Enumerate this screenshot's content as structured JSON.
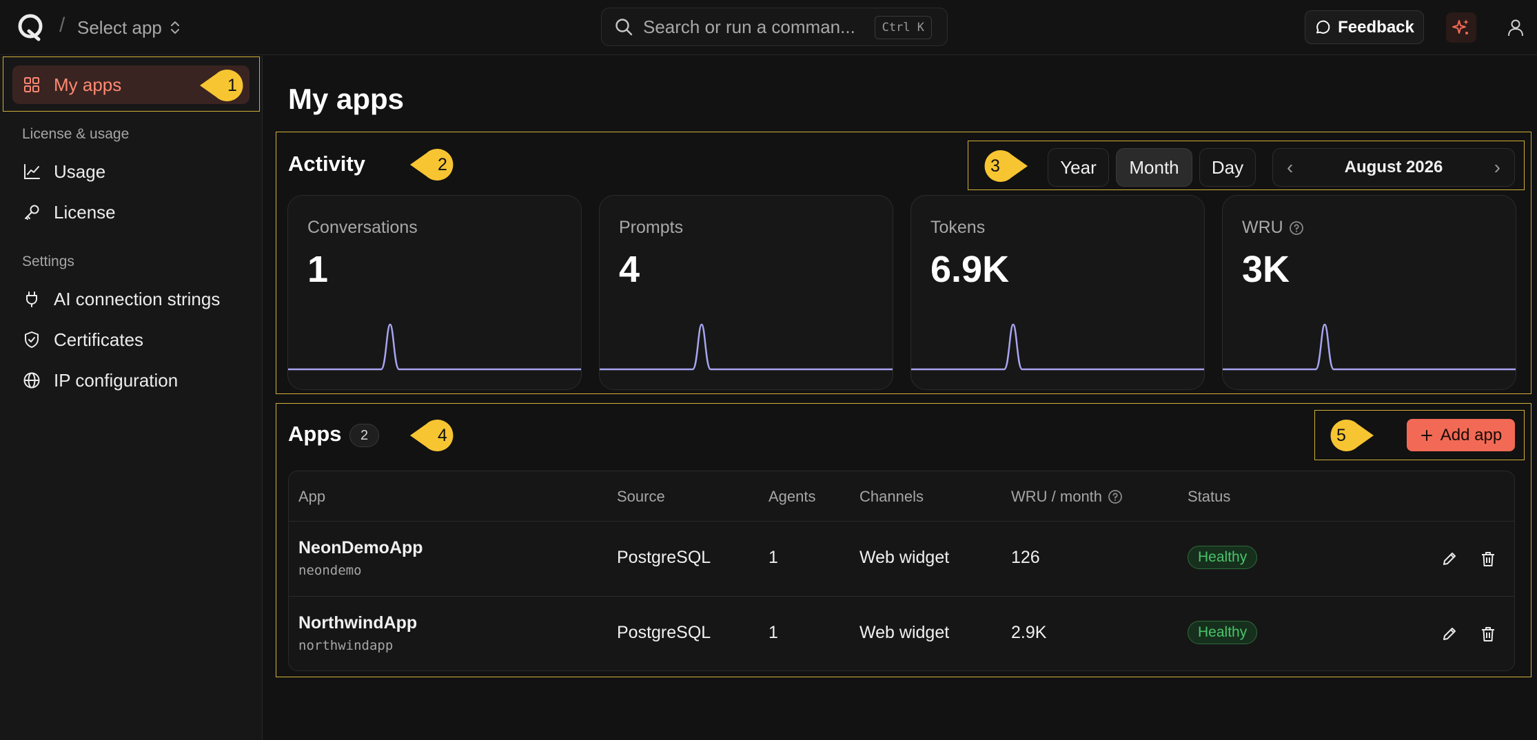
{
  "header": {
    "app_selector_label": "Select app",
    "breadcrumb_separator": "/",
    "search_placeholder": "Search or run a comman...",
    "search_shortcut": "Ctrl K",
    "feedback_label": "Feedback"
  },
  "sidebar": {
    "my_apps": "My apps",
    "license_heading": "License & usage",
    "usage": "Usage",
    "license": "License",
    "settings_heading": "Settings",
    "ai_connection_strings": "AI connection strings",
    "certificates": "Certificates",
    "ip_configuration": "IP configuration"
  },
  "main": {
    "title": "My apps",
    "activity_title": "Activity",
    "range_options": [
      "Year",
      "Month",
      "Day"
    ],
    "range_selected": "Month",
    "period": "August 2026",
    "metrics": [
      {
        "label": "Conversations",
        "value": "1",
        "help": false
      },
      {
        "label": "Prompts",
        "value": "4",
        "help": false
      },
      {
        "label": "Tokens",
        "value": "6.9K",
        "help": false
      },
      {
        "label": "WRU",
        "value": "3K",
        "help": true
      }
    ],
    "apps_title": "Apps",
    "apps_count": "2",
    "add_app_label": "Add app",
    "table": {
      "columns": [
        "App",
        "Source",
        "Agents",
        "Channels",
        "WRU / month",
        "Status"
      ],
      "rows": [
        {
          "name": "NeonDemoApp",
          "slug": "neondemo",
          "source": "PostgreSQL",
          "agents": "1",
          "channels": "Web widget",
          "wru": "126",
          "status": "Healthy"
        },
        {
          "name": "NorthwindApp",
          "slug": "northwindapp",
          "source": "PostgreSQL",
          "agents": "1",
          "channels": "Web widget",
          "wru": "2.9K",
          "status": "Healthy"
        }
      ]
    }
  },
  "annotations": [
    "1",
    "2",
    "3",
    "4",
    "5"
  ],
  "colors": {
    "accent": "#f26a55",
    "active_text": "#ff8a73",
    "sparkline": "#a8a4f0",
    "healthy": "#4bc46a",
    "annotation": "#f7c531"
  },
  "icons": {
    "logo": "app-logo",
    "selector": "chevron-up-down-icon",
    "search": "search-icon",
    "feedback": "message-circle-icon",
    "ai": "sparkles-icon",
    "user": "user-icon",
    "my_apps": "grid-icon",
    "usage": "chart-line-icon",
    "license": "key-icon",
    "ai_connection_strings": "plug-icon",
    "certificates": "shield-check-icon",
    "ip_configuration": "globe-icon",
    "help": "help-circle-icon",
    "prev": "chevron-left-icon",
    "next": "chevron-right-icon",
    "add": "plus-icon",
    "edit": "pencil-icon",
    "delete": "trash-icon"
  }
}
